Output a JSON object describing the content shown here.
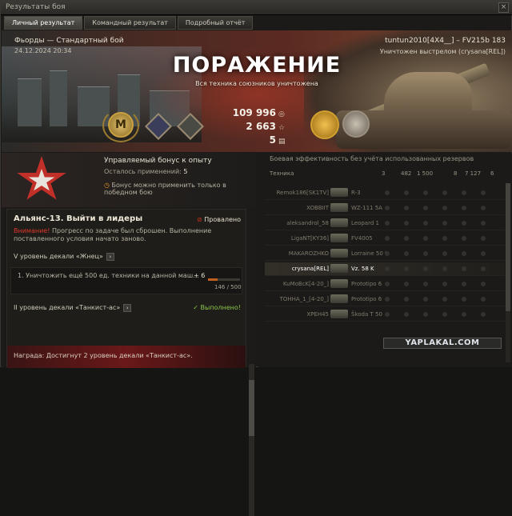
{
  "window": {
    "title": "Результаты боя",
    "close": "×"
  },
  "tabs": [
    "Личный результат",
    "Командный результат",
    "Подробный отчёт"
  ],
  "banner": {
    "map": "Фьорды — Стандартный бой",
    "date": "24.12.2024 20:34",
    "player": "tuntun2010[4X4__] – FV215b 183",
    "killed_by": "Уничтожен выстрелом (crysana[REL])",
    "result": "ПОРАЖЕНИЕ",
    "subtitle": "Вся техника союзников уничтожена",
    "credits": "109 996",
    "xp": "2 663",
    "free_xp": "5",
    "m_medal": "M"
  },
  "bonus": {
    "title": "Управляемый бонус к опыту",
    "uses_label": "Осталось применений:",
    "uses_value": "5",
    "warning": "Бонус можно применить только в победном бою"
  },
  "mission": {
    "title": "Альянс-13. Выйти в лидеры",
    "status": "Провалено",
    "note_label": "Внимание!",
    "note_text": "Прогресс по задаче был сброшен. Выполнение поставленного условия начато заново.",
    "section1": "V уровень декали «Жнец»",
    "task": "1. Уничтожить ещё 500 ед. техники на данной маш...",
    "task_plus": "+ 6",
    "task_count": "146 / 500",
    "task_progress": 0.292,
    "section2": "II уровень декали «Танкист-ас»",
    "done": "Выполнено!",
    "reward": "Награда:  Достигнут 2 уровень декали «Танкист-ас»."
  },
  "right": {
    "efficiency": "Боевая эффективность без учёта использованных резервов",
    "col_vehicle": "Техника",
    "cols": [
      "3",
      "482",
      "1 500",
      "8",
      "7 127",
      "6"
    ],
    "rows": [
      {
        "player": "Remok186[SK1TV]",
        "tank": "R-3"
      },
      {
        "player": "XOBBIIT",
        "tank": "WZ-111 5A"
      },
      {
        "player": "aleksandrol_58",
        "tank": "Leopard 1"
      },
      {
        "player": "LigaNT[KY36]",
        "tank": "FV4005"
      },
      {
        "player": "MAKAROZHKO",
        "tank": "Lorraine 50 t"
      },
      {
        "player": "crysana[REL]",
        "tank": "Vz. 58 K"
      },
      {
        "player": "KuMoBcK[4-20_]",
        "tank": "Prototipo 6"
      },
      {
        "player": "ТОННА_1_[4-20_]",
        "tank": "Prototipo 6"
      },
      {
        "player": "XPEH45",
        "tank": "Škoda T 50"
      }
    ]
  },
  "watermark": "YAPLAKAL.COM"
}
